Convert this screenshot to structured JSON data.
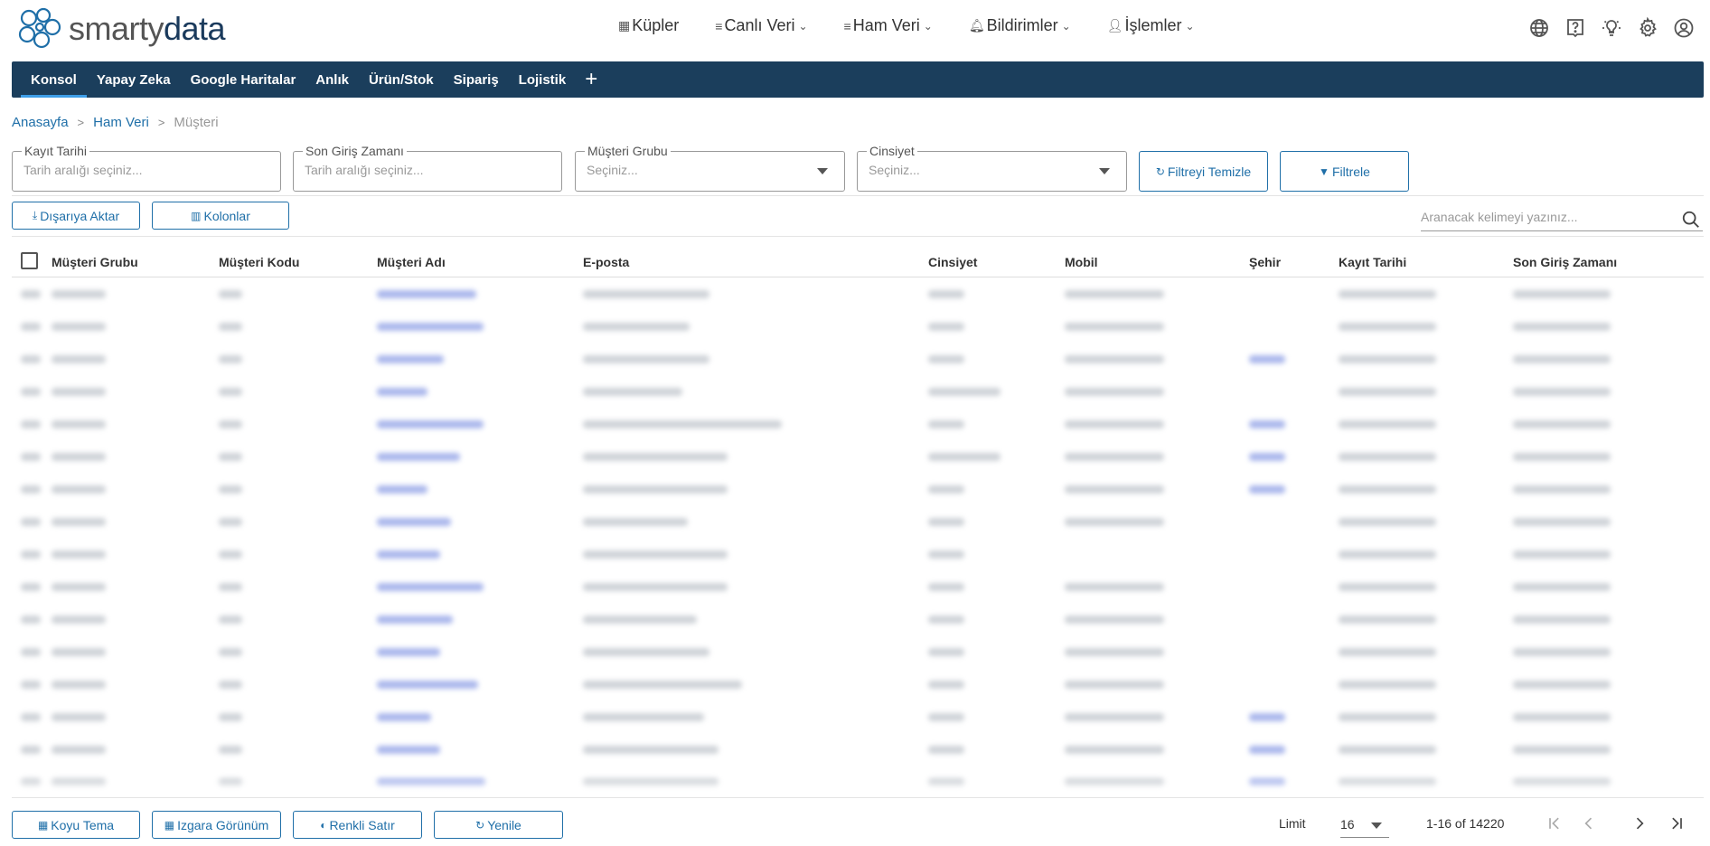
{
  "logo": {
    "part1": "smarty",
    "part2": "data"
  },
  "topnav": [
    {
      "label": "Küpler",
      "icon": "cubes-icon",
      "has_menu": false
    },
    {
      "label": "Canlı Veri",
      "icon": "list-icon",
      "has_menu": true
    },
    {
      "label": "Ham Veri",
      "icon": "list-icon",
      "has_menu": true
    },
    {
      "label": "Bildirimler",
      "icon": "bell-icon",
      "has_menu": true
    },
    {
      "label": "İşlemler",
      "icon": "user-cog-icon",
      "has_menu": true
    }
  ],
  "top_icons": [
    "globe-icon",
    "help-icon",
    "lightbulb-icon",
    "gear-icon",
    "account-icon"
  ],
  "menubar": {
    "items": [
      "Konsol",
      "Yapay Zeka",
      "Google Haritalar",
      "Anlık",
      "Ürün/Stok",
      "Sipariş",
      "Lojistik"
    ],
    "active_index": 0,
    "plus": "+"
  },
  "breadcrumb": {
    "home": "Anasayfa",
    "section": "Ham Veri",
    "current": "Müşteri"
  },
  "filters": {
    "kayit_tarihi": {
      "label": "Kayıt Tarihi",
      "placeholder": "Tarih aralığı seçiniz..."
    },
    "son_giris": {
      "label": "Son Giriş Zamanı",
      "placeholder": "Tarih aralığı seçiniz..."
    },
    "musteri_grubu": {
      "label": "Müşteri Grubu",
      "placeholder": "Seçiniz..."
    },
    "cinsiyet": {
      "label": "Cinsiyet",
      "placeholder": "Seçiniz..."
    },
    "clear_label": "Filtreyi Temizle",
    "apply_label": "Filtrele"
  },
  "toolbar": {
    "export_label": "Dışarıya Aktar",
    "columns_label": "Kolonlar"
  },
  "search": {
    "placeholder": "Aranacak kelimeyi yazınız..."
  },
  "table": {
    "columns": [
      "Müşteri Grubu",
      "Müşteri Kodu",
      "Müşteri Adı",
      "E-posta",
      "Cinsiyet",
      "Mobil",
      "Şehir",
      "Kayıt Tarihi",
      "Son Giriş Zamanı"
    ]
  },
  "footer": {
    "dark_theme_label": "Koyu Tema",
    "grid_view_label": "Izgara Görünüm",
    "colored_row_label": "Renkli Satır",
    "refresh_label": "Yenile",
    "limit_label": "Limit",
    "limit_value": "16",
    "range": "1-16 of 14220"
  },
  "colors": {
    "brand_dark": "#1b3e5c",
    "accent": "#1f6fa8",
    "active_underline": "#3d9ee8"
  }
}
